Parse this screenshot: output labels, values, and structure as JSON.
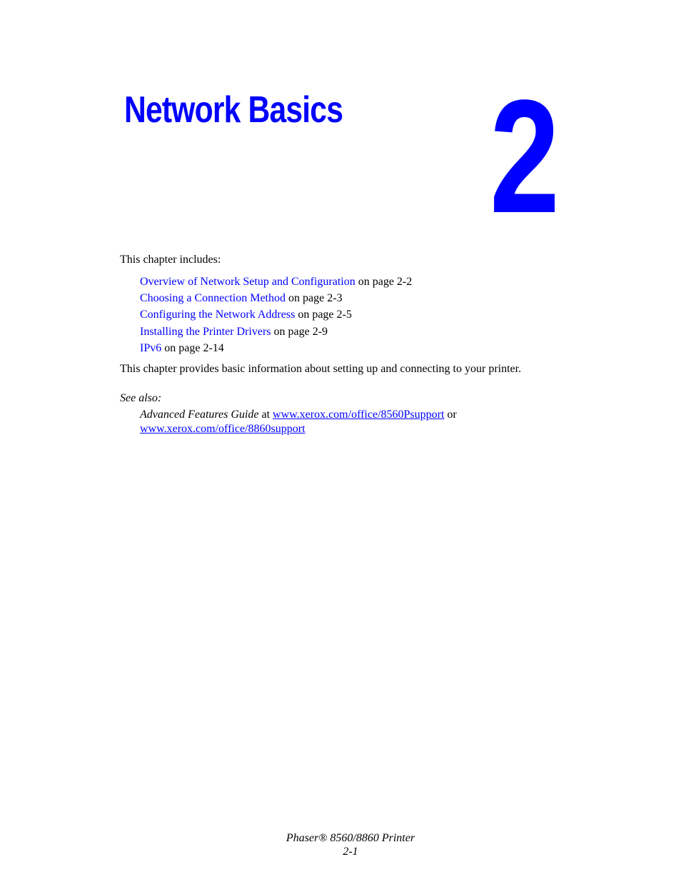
{
  "chapter": {
    "title": "Network Basics",
    "number": "2"
  },
  "intro": "This chapter includes:",
  "toc": [
    {
      "link": "Overview of Network Setup and Configuration",
      "suffix": " on page 2-2"
    },
    {
      "link": "Choosing a Connection Method",
      "suffix": " on page 2-3"
    },
    {
      "link": "Configuring the Network Address",
      "suffix": " on page 2-5"
    },
    {
      "link": "Installing the Printer Drivers",
      "suffix": " on page 2-9"
    },
    {
      "link": "IPv6",
      "suffix": " on page 2-14"
    }
  ],
  "summary": "This chapter provides basic information about setting up and connecting to your printer.",
  "see_also": {
    "label": "See also:",
    "guide_title": "Advanced Features Guide",
    "at": " at ",
    "url1": "www.xerox.com/office/8560Psupport",
    "or": " or",
    "url2": "www.xerox.com/office/8860support"
  },
  "footer": {
    "product": "Phaser® 8560/8860 Printer",
    "page": "2-1"
  },
  "colors": {
    "accent": "#0000ff"
  }
}
